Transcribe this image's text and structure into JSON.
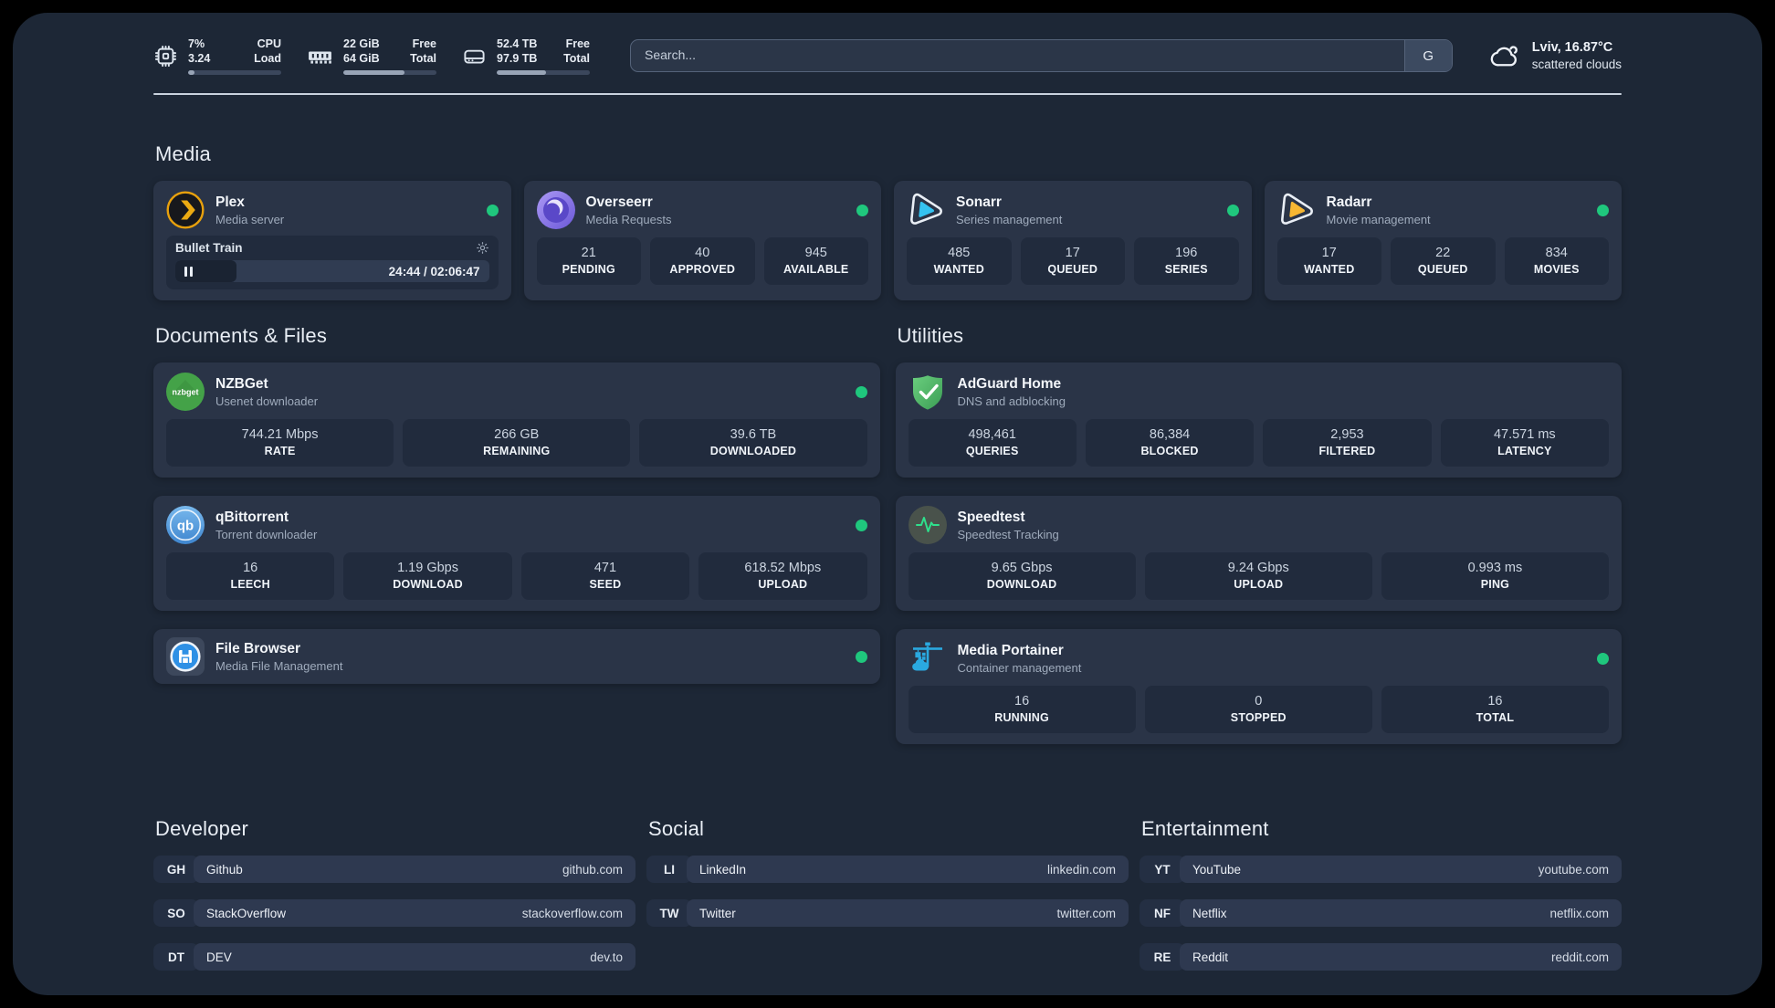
{
  "colors": {
    "background": "#000000",
    "panel": "#1d2736",
    "card": "#2a3447",
    "stat_box": "#212b3d",
    "status_online": "#1fc77d",
    "plex_amber": "#e7a00d",
    "sonarr_cyan": "#35c3f1",
    "radarr_orange": "#f7b733",
    "adguard_green": "#57c06a",
    "qbittorrent_blue": "#4a90d9",
    "nzbget_green": "#44a248",
    "filebrowser_blue": "#2e90e5",
    "portainer_blue": "#2aa9e0",
    "speedtest_pulse": "#2ee08c"
  },
  "topbar": {
    "cpu": {
      "value_line1": "7%",
      "value_line2": "3.24",
      "label_line1": "CPU",
      "label_line2": "Load",
      "progress_pct": 7
    },
    "memory": {
      "value_line1": "22 GiB",
      "value_line2": "64 GiB",
      "label_line1": "Free",
      "label_line2": "Total",
      "progress_pct": 66
    },
    "disk": {
      "value_line1": "52.4 TB",
      "value_line2": "97.9 TB",
      "label_line1": "Free",
      "label_line2": "Total",
      "progress_pct": 53
    },
    "search": {
      "placeholder": "Search...",
      "engine_label": "G"
    },
    "weather": {
      "line1": "Lviv, 16.87°C",
      "line2": "scattered clouds"
    }
  },
  "sections": {
    "media": {
      "title": "Media",
      "cards": [
        {
          "name": "Plex",
          "desc": "Media server",
          "status": "online",
          "nowplaying": {
            "title": "Bullet Train",
            "time": "24:44 / 02:06:47",
            "progress_pct": 19.5
          }
        },
        {
          "name": "Overseerr",
          "desc": "Media Requests",
          "status": "online",
          "stats": [
            {
              "value": "21",
              "label": "PENDING"
            },
            {
              "value": "40",
              "label": "APPROVED"
            },
            {
              "value": "945",
              "label": "AVAILABLE"
            }
          ]
        },
        {
          "name": "Sonarr",
          "desc": "Series management",
          "status": "online",
          "stats": [
            {
              "value": "485",
              "label": "WANTED"
            },
            {
              "value": "17",
              "label": "QUEUED"
            },
            {
              "value": "196",
              "label": "SERIES"
            }
          ]
        },
        {
          "name": "Radarr",
          "desc": "Movie management",
          "status": "online",
          "stats": [
            {
              "value": "17",
              "label": "WANTED"
            },
            {
              "value": "22",
              "label": "QUEUED"
            },
            {
              "value": "834",
              "label": "MOVIES"
            }
          ]
        }
      ]
    },
    "documents": {
      "title": "Documents & Files",
      "cards": [
        {
          "name": "NZBGet",
          "desc": "Usenet downloader",
          "status": "online",
          "stats": [
            {
              "value": "744.21 Mbps",
              "label": "RATE"
            },
            {
              "value": "266 GB",
              "label": "REMAINING"
            },
            {
              "value": "39.6 TB",
              "label": "DOWNLOADED"
            }
          ]
        },
        {
          "name": "qBittorrent",
          "desc": "Torrent downloader",
          "status": "online",
          "stats": [
            {
              "value": "16",
              "label": "LEECH"
            },
            {
              "value": "1.19 Gbps",
              "label": "DOWNLOAD"
            },
            {
              "value": "471",
              "label": "SEED"
            },
            {
              "value": "618.52 Mbps",
              "label": "UPLOAD"
            }
          ]
        },
        {
          "name": "File Browser",
          "desc": "Media File Management",
          "status": "online",
          "stats": []
        }
      ]
    },
    "utilities": {
      "title": "Utilities",
      "cards": [
        {
          "name": "AdGuard Home",
          "desc": "DNS and adblocking",
          "stats": [
            {
              "value": "498,461",
              "label": "QUERIES"
            },
            {
              "value": "86,384",
              "label": "BLOCKED"
            },
            {
              "value": "2,953",
              "label": "FILTERED"
            },
            {
              "value": "47.571 ms",
              "label": "LATENCY"
            }
          ]
        },
        {
          "name": "Speedtest",
          "desc": "Speedtest Tracking",
          "stats": [
            {
              "value": "9.65 Gbps",
              "label": "DOWNLOAD"
            },
            {
              "value": "9.24 Gbps",
              "label": "UPLOAD"
            },
            {
              "value": "0.993 ms",
              "label": "PING"
            }
          ]
        },
        {
          "name": "Media Portainer",
          "desc": "Container management",
          "status": "online",
          "stats": [
            {
              "value": "16",
              "label": "RUNNING"
            },
            {
              "value": "0",
              "label": "STOPPED"
            },
            {
              "value": "16",
              "label": "TOTAL"
            }
          ]
        }
      ]
    },
    "links": {
      "developer": {
        "title": "Developer",
        "items": [
          {
            "abbr": "GH",
            "name": "Github",
            "url": "github.com"
          },
          {
            "abbr": "SO",
            "name": "StackOverflow",
            "url": "stackoverflow.com"
          },
          {
            "abbr": "DT",
            "name": "DEV",
            "url": "dev.to"
          }
        ]
      },
      "social": {
        "title": "Social",
        "items": [
          {
            "abbr": "LI",
            "name": "LinkedIn",
            "url": "linkedin.com"
          },
          {
            "abbr": "TW",
            "name": "Twitter",
            "url": "twitter.com"
          }
        ]
      },
      "entertainment": {
        "title": "Entertainment",
        "items": [
          {
            "abbr": "YT",
            "name": "YouTube",
            "url": "youtube.com"
          },
          {
            "abbr": "NF",
            "name": "Netflix",
            "url": "netflix.com"
          },
          {
            "abbr": "RE",
            "name": "Reddit",
            "url": "reddit.com"
          }
        ]
      }
    }
  },
  "icons": {
    "nzbget_label": "nzbget",
    "qbittorrent_label": "qb"
  }
}
